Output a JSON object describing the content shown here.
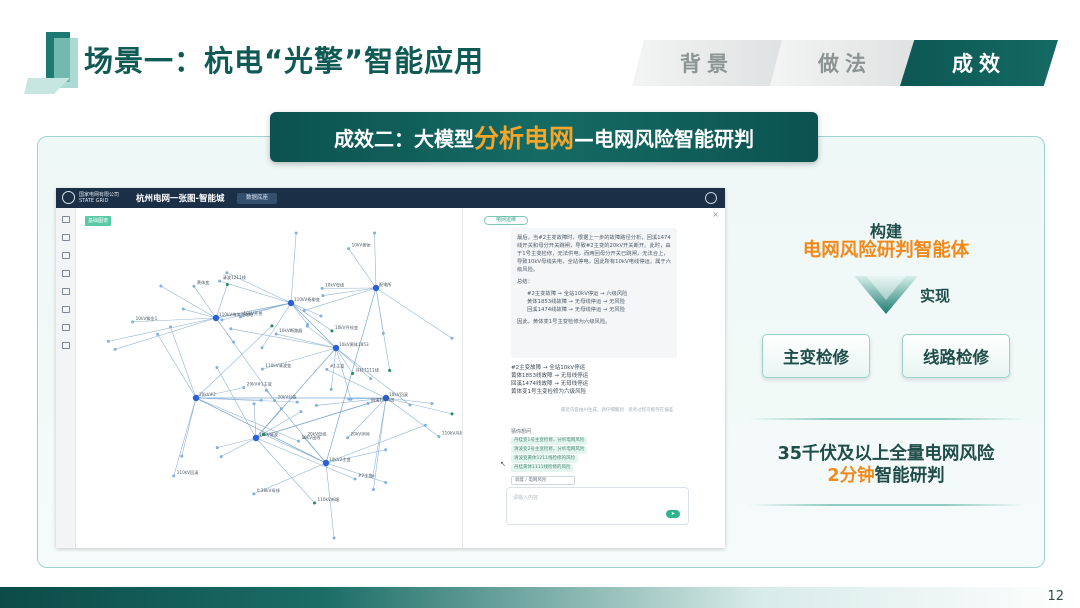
{
  "header": {
    "title": "场景一：杭电“光擎”智能应用",
    "tabs": [
      {
        "label": "背景",
        "active": false
      },
      {
        "label": "做法",
        "active": false
      },
      {
        "label": "成效",
        "active": true
      }
    ]
  },
  "banner": {
    "prefix": "成效二：大模型",
    "highlight": "分析电网",
    "suffix": "—电网风险智能研判"
  },
  "screenshot": {
    "company": [
      "国家电网有限公司",
      "STATE GRID"
    ],
    "app_title": "杭州电网一张图-智能城",
    "top_button": "数据底座",
    "graph_tag": "基础图谱",
    "chat_tag": "电网运维",
    "chat_card": {
      "intro": "最后，当#2主变故障时，根据上一步的故障路径分析，回溪1474线开关和母分开关跳闸，导致#2主变的20kV开关断开。此时，由于1号主变检修，无法供电，而两回母分开关已跳闸，无法合上，导致10kV母线失电，全站停电，因此所有10kV电线停运，属于六级风险。",
      "summary_title": "总结：",
      "summary_lines": [
        "#2主变故障 → 全站10kV停运 → 六级风险",
        "黄体1853线故障 → 无母线停运 → 无风险",
        "回溪1474线故障 → 无母线停运 → 无风险"
      ],
      "conclusion": "因此，黄体变1号主变检修为六级风险。"
    },
    "chat_lines": [
      "#2主变故障 → 全站10kV停运",
      "黄体1853线故障 → 无母线停运",
      "回溪1474线故障 → 无母线停运",
      "黄体变1号主变检修为六级风险"
    ],
    "chat_footer": "最近内容由AI生成，请仔细甄别 · 思考过程可能存在偏差",
    "quick_title": "猜你想问",
    "quick_items": [
      "丹桂变1号主变检修，分析电网风险",
      "清波变2号主变检修，分析电网风险",
      "清波变黄体1211线检修的风险",
      "丹桂黄体1111线检修的风险"
    ],
    "select_value": "调度 / 电网风险",
    "input_placeholder": "请输入内容",
    "send_label": "➤",
    "graph_labels": [
      "110kV梅城变电站",
      "110kV杨柳变",
      "10kV黄体1853",
      "10kV清波",
      "10kV回溪",
      "20kV#2",
      "10kV2主变",
      "配电所",
      "10kV紫金1",
      "10kV丹桂变",
      "110kV清波变",
      "#2主变",
      "#1主变",
      "110kV回溪",
      "20kV母线",
      "10kV母线",
      "黄体变",
      "清波1211线",
      "丹桂1111线",
      "回溪1474线",
      "110kV丹桂变",
      "20kV#1主变",
      "0.38kV母线",
      "10kV黄体",
      "20kV分段",
      "10kV开关",
      "10kV断路器",
      "110kV新塘",
      "20kV环网",
      "10kV出线"
    ]
  },
  "right": {
    "build_label": "构建",
    "build_sub": "电网风险研判智能体",
    "impl_label": "实现",
    "actions": [
      "主变检修",
      "线路检修"
    ],
    "result_line1": "35千伏及以上全量电网风险",
    "result_line2_highlight": "2分钟",
    "result_line2_suffix": "智能研判"
  },
  "footer": {
    "page_number": "12"
  },
  "colors": {
    "primary": "#0f5a55",
    "accent": "#f08a1c",
    "banner_highlight": "#f4a52a"
  }
}
